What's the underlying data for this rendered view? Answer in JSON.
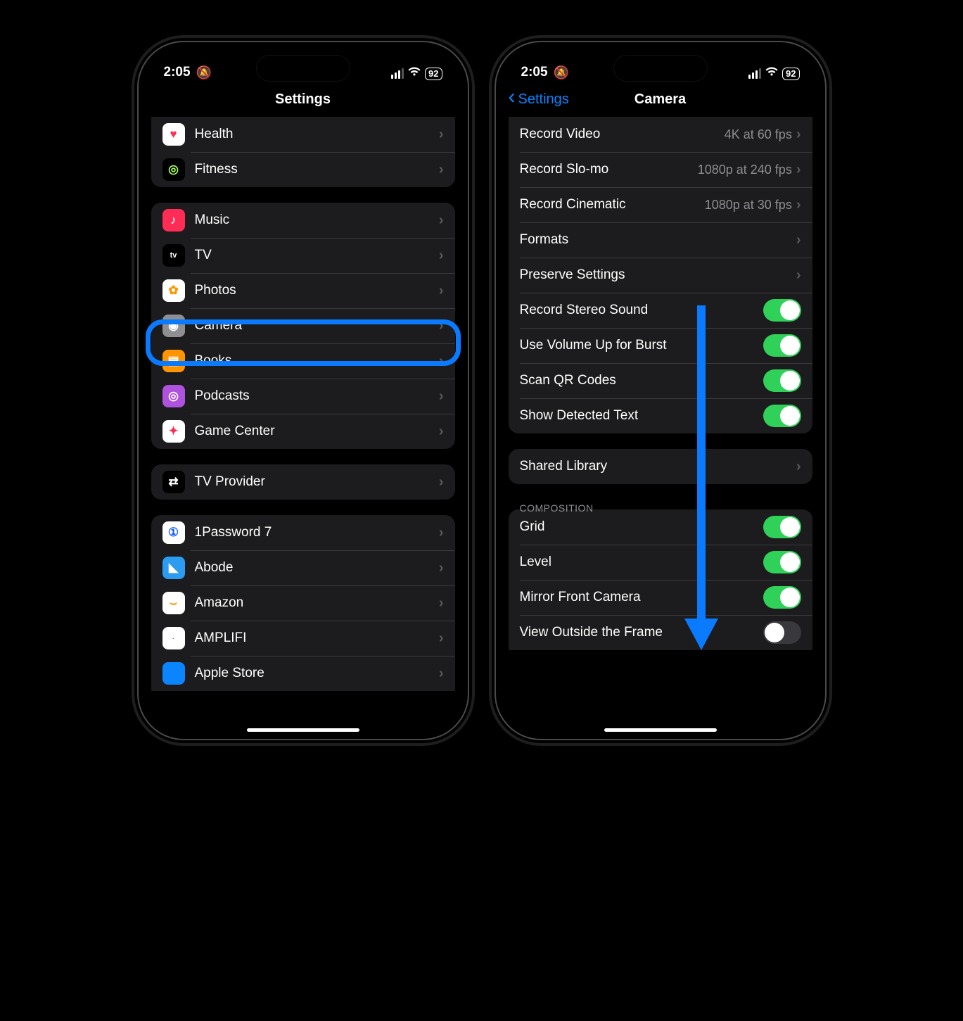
{
  "status": {
    "time": "2:05",
    "battery": "92"
  },
  "left": {
    "title": "Settings",
    "group1": [
      {
        "name": "Health",
        "iconBg": "#ffffff",
        "iconText": "♥",
        "iconColor": "#ff2d55"
      },
      {
        "name": "Fitness",
        "iconBg": "#000000",
        "iconText": "◎",
        "iconColor": "#a6ff4d"
      }
    ],
    "group2": [
      {
        "name": "Music",
        "iconBg": "#ff2d55",
        "iconText": "♪"
      },
      {
        "name": "TV",
        "iconBg": "#000000",
        "iconText": "tv",
        "small": true
      },
      {
        "name": "Photos",
        "iconBg": "#ffffff",
        "iconText": "✿",
        "iconColor": "#ff9500"
      },
      {
        "name": "Camera",
        "iconBg": "#8e8e93",
        "iconText": "◉",
        "highlight": true
      },
      {
        "name": "Books",
        "iconBg": "#ff9500",
        "iconText": "▤"
      },
      {
        "name": "Podcasts",
        "iconBg": "#af52de",
        "iconText": "◎"
      },
      {
        "name": "Game Center",
        "iconBg": "#ffffff",
        "iconText": "✦",
        "iconColor": "#ff2d55"
      }
    ],
    "group3": [
      {
        "name": "TV Provider",
        "iconBg": "#000000",
        "iconText": "⇄"
      }
    ],
    "group4": [
      {
        "name": "1Password 7",
        "iconBg": "#ffffff",
        "iconText": "①",
        "iconColor": "#1a5cff"
      },
      {
        "name": "Abode",
        "iconBg": "#2c9cf2",
        "iconText": "◣"
      },
      {
        "name": "Amazon",
        "iconBg": "#ffffff",
        "iconText": "⌣",
        "iconColor": "#ff9900"
      },
      {
        "name": "AMPLIFI",
        "iconBg": "#ffffff",
        "iconText": "·",
        "iconColor": "#555",
        "tiny": true
      },
      {
        "name": "Apple Store",
        "iconBg": "#0a84ff",
        "iconText": ""
      }
    ]
  },
  "right": {
    "back": "Settings",
    "title": "Camera",
    "group1": [
      {
        "name": "Record Video",
        "detail": "4K at 60 fps",
        "chev": true
      },
      {
        "name": "Record Slo-mo",
        "detail": "1080p at 240 fps",
        "chev": true
      },
      {
        "name": "Record Cinematic",
        "detail": "1080p at 30 fps",
        "chev": true
      },
      {
        "name": "Formats",
        "chev": true
      },
      {
        "name": "Preserve Settings",
        "chev": true
      },
      {
        "name": "Record Stereo Sound",
        "toggle": true,
        "on": true
      },
      {
        "name": "Use Volume Up for Burst",
        "toggle": true,
        "on": true
      },
      {
        "name": "Scan QR Codes",
        "toggle": true,
        "on": true
      },
      {
        "name": "Show Detected Text",
        "toggle": true,
        "on": true
      }
    ],
    "group2": [
      {
        "name": "Shared Library",
        "chev": true
      }
    ],
    "sectionHeader": "COMPOSITION",
    "group3": [
      {
        "name": "Grid",
        "toggle": true,
        "on": true
      },
      {
        "name": "Level",
        "toggle": true,
        "on": true
      },
      {
        "name": "Mirror Front Camera",
        "toggle": true,
        "on": true
      },
      {
        "name": "View Outside the Frame",
        "toggle": true,
        "on": false
      }
    ]
  }
}
